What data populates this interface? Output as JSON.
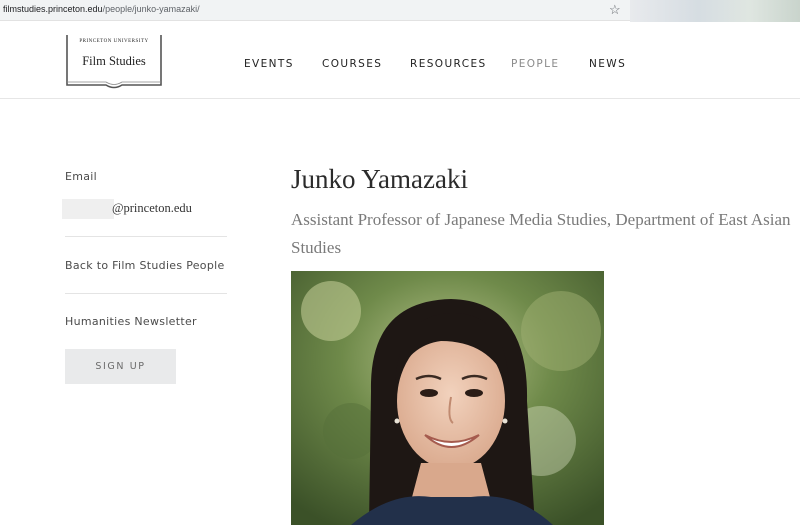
{
  "browser": {
    "url_domain": "filmstudies.princeton.edu",
    "url_path": "/people/junko-yamazaki/",
    "bookmark_icon": "star-icon"
  },
  "header": {
    "logo_university": "PRINCETON UNIVERSITY",
    "logo_title": "Film Studies",
    "nav": [
      "EVENTS",
      "COURSES",
      "RESOURCES",
      "PEOPLE",
      "NEWS"
    ],
    "active_nav": "PEOPLE"
  },
  "sidebar": {
    "email_label": "Email",
    "email_domain": "@princeton.edu",
    "back_link": "Back to Film Studies People",
    "newsletter_label": "Humanities Newsletter",
    "signup_label": "SIGN UP"
  },
  "profile": {
    "name": "Junko Yamazaki",
    "title": "Assistant Professor of Japanese Media Studies, Department of East Asian Studies"
  },
  "colors": {
    "nav_active": "#8a8a8a",
    "title_text": "#7a7a7a",
    "button_bg": "#e9eaeb"
  }
}
